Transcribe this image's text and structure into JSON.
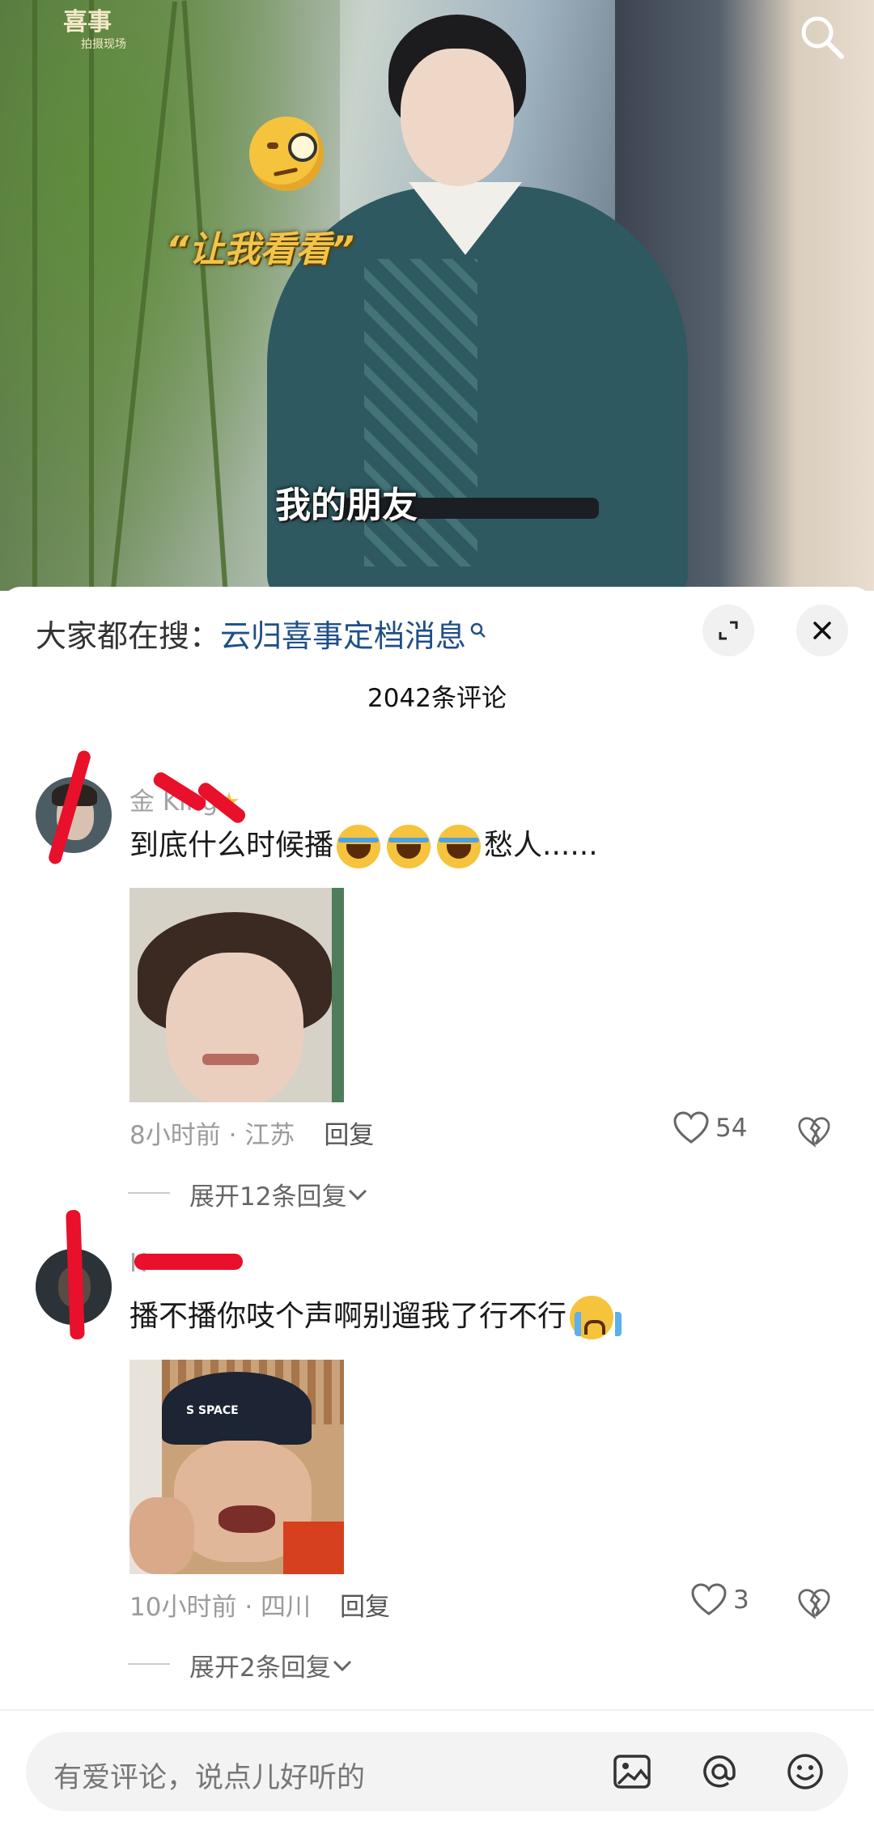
{
  "video": {
    "watermark_title": "喜事",
    "watermark_sub": "拍摄现场",
    "caption_top": "“让我看看”",
    "caption_bottom": "我的朋友"
  },
  "panel": {
    "hot_search_prefix": "大家都在搜：",
    "hot_search_term": "云归喜事定档消息",
    "comment_count": "2042条评论"
  },
  "comments": [
    {
      "username": "金 King",
      "text_before": "到底什么时候播",
      "text_after": "愁人......",
      "emoji_count": 3,
      "time": "8小时前",
      "location": "江苏",
      "reply_label": "回复",
      "likes": "54",
      "expand_label": "展开12条回复"
    },
    {
      "username": "K",
      "text_before": "播不播你吱个声啊别遛我了行不行",
      "time": "10小时前",
      "location": "四川",
      "reply_label": "回复",
      "likes": "3",
      "expand_label": "展开2条回复"
    }
  ],
  "meta_separator": "·",
  "input": {
    "placeholder": "有爱评论，说点儿好听的"
  },
  "colors": {
    "link": "#1f4f86",
    "redmark": "#e8102a"
  }
}
